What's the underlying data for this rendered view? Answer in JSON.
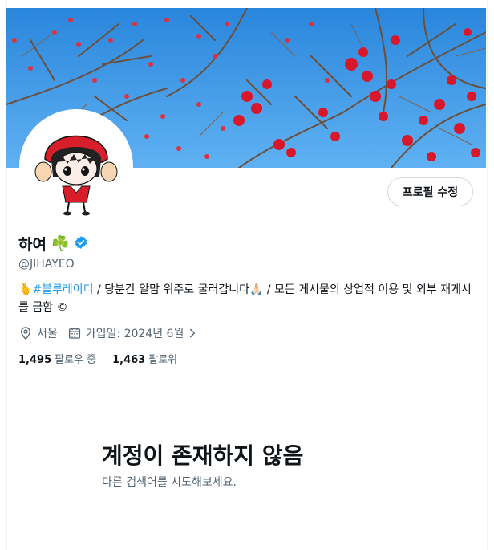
{
  "profile": {
    "edit_button": "프로필 수정",
    "name": "하여",
    "name_emoji": "☘️",
    "handle": "@JIHAYEO",
    "bio": {
      "lead_emoji": "🫰",
      "hashtag": "#블루레이디",
      "text1": " / 당분간 알맘 위주로 굴러갑니다",
      "emoji2": "🙏🏻",
      "text2": " / 모든 게시물의 상업적 이용 및 외부 재게시를 금함 ©"
    },
    "location": "서울",
    "joined": "가입일: 2024년 6월",
    "following_count": "1,495",
    "following_label": "팔로우 중",
    "followers_count": "1,463",
    "followers_label": "팔로워"
  },
  "empty_state": {
    "title": "계정이 존재하지 않음",
    "subtitle": "다른 검색어를 시도해보세요."
  },
  "colors": {
    "accent": "#1d9bf0",
    "text_primary": "#0f1419",
    "text_secondary": "#536471",
    "border": "#cfd9de"
  }
}
